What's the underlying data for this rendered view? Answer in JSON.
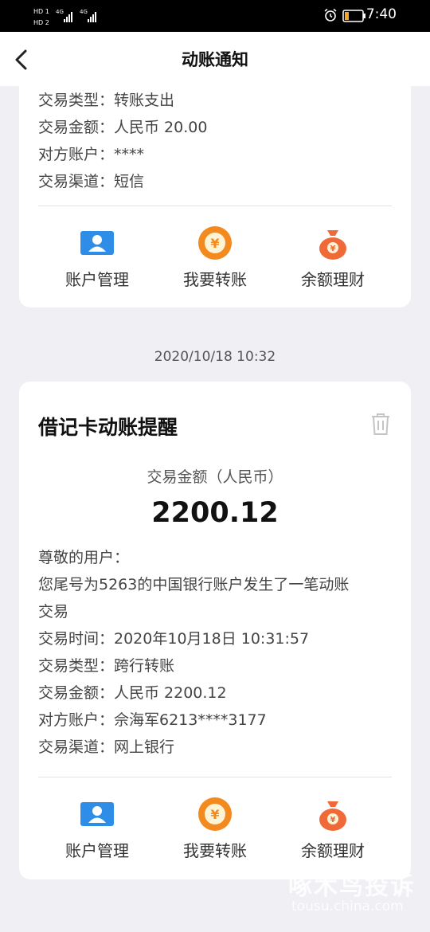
{
  "status_bar": {
    "time": "7:40",
    "signal_left": "HD 1  4G",
    "signal_right": "HD 2  4G"
  },
  "header": {
    "title": "动账通知"
  },
  "card1": {
    "rows": [
      "交易类型：转账支出",
      "交易金额：人民币 20.00",
      "对方账户：****",
      "交易渠道：短信"
    ],
    "actions": [
      {
        "label": "账户管理",
        "icon": "account-card-icon"
      },
      {
        "label": "我要转账",
        "icon": "yuan-coin-icon"
      },
      {
        "label": "余额理财",
        "icon": "money-bag-icon"
      }
    ]
  },
  "separator_date": "2020/10/18 10:32",
  "card2": {
    "title": "借记卡动账提醒",
    "amount_label": "交易金额（人民币）",
    "amount": "2200.12",
    "rows": [
      "尊敬的用户：",
      "您尾号为5263的中国银行账户发生了一笔动账",
      "交易",
      "交易时间：2020年10月18日 10:31:57",
      "交易类型：跨行转账",
      "交易金额：人民币 2200.12",
      "对方账户：佘海军6213****3177",
      "交易渠道：网上银行"
    ],
    "actions": [
      {
        "label": "账户管理",
        "icon": "account-card-icon"
      },
      {
        "label": "我要转账",
        "icon": "yuan-coin-icon"
      },
      {
        "label": "余额理财",
        "icon": "money-bag-icon"
      }
    ]
  },
  "watermark": {
    "line1": "啄木鸟投诉",
    "line2": "tousu.china.com"
  },
  "colors": {
    "accent_blue": "#2e8de6",
    "accent_orange": "#f28a1f",
    "accent_red_orange": "#ef6a38",
    "background": "#efeff4"
  }
}
